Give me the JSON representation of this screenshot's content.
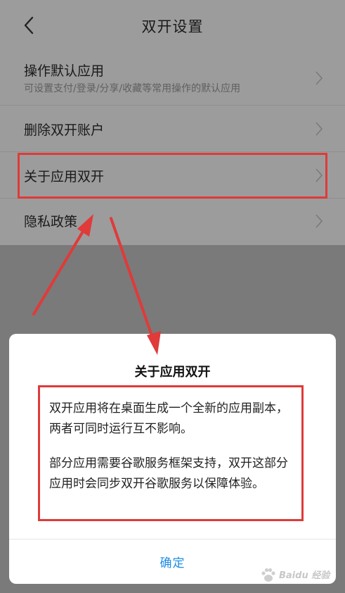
{
  "header": {
    "title": "双开设置"
  },
  "settings_list": {
    "items": [
      {
        "label": "操作默认应用",
        "description": "可设置支付/登录/分享/收藏等常用操作的默认应用"
      },
      {
        "label": "删除双开账户"
      },
      {
        "label": "关于应用双开"
      },
      {
        "label": "隐私政策"
      }
    ]
  },
  "dialog": {
    "title": "关于应用双开",
    "paragraphs": [
      "双开应用将在桌面生成一个全新的应用副本，两者可同时运行互不影响。",
      "部分应用需要谷歌服务框架支持，双开这部分应用时会同步双开谷歌服务以保障体验。"
    ],
    "confirm_label": "确定"
  },
  "watermark": {
    "text": "Baidu 经验"
  },
  "colors": {
    "annotation_red": "#e03a3a",
    "link_blue": "#1e8ce3"
  }
}
